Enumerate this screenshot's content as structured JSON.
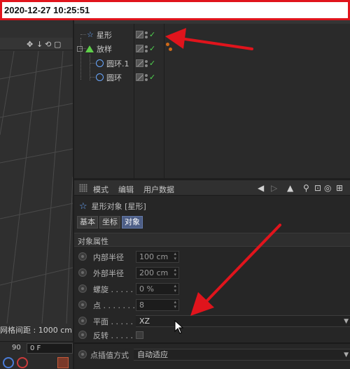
{
  "timestamp": "2020-12-27  10:25:51",
  "viewport": {
    "grid_spacing_label": "网格间距 : 1000 cm",
    "frame_number": "90",
    "frame_field": "0 F"
  },
  "object_manager": {
    "objects": [
      {
        "name": "星形",
        "icon": "star-icon",
        "depth": 0
      },
      {
        "name": "放样",
        "icon": "loft-icon",
        "depth": 0
      },
      {
        "name": "圆环.1",
        "icon": "circle-icon",
        "depth": 1
      },
      {
        "name": "圆环",
        "icon": "circle-icon",
        "depth": 1
      }
    ]
  },
  "attribute_manager": {
    "menu": [
      "模式",
      "编辑",
      "用户数据"
    ],
    "title": "星形对象 [星形]",
    "tabs": [
      "基本",
      "坐标",
      "对象"
    ],
    "active_tab": "对象",
    "section_title": "对象属性",
    "properties": [
      {
        "label": "内部半径",
        "value": "100 cm"
      },
      {
        "label": "外部半径",
        "value": "200 cm"
      },
      {
        "label": "螺旋 . . . . .",
        "value": "0 %"
      },
      {
        "label": "点 . . . . . . .",
        "value": "8"
      },
      {
        "label": "平面 . . . . . .",
        "value": "XZ"
      },
      {
        "label": "反转 . . . . . .",
        "value": ""
      }
    ],
    "interpolation": {
      "label": "点插值方式",
      "value": "自动适应"
    }
  },
  "colors": {
    "arrow": "#e0141c",
    "active_tab": "#4d5e86",
    "check": "#4fd34f"
  }
}
